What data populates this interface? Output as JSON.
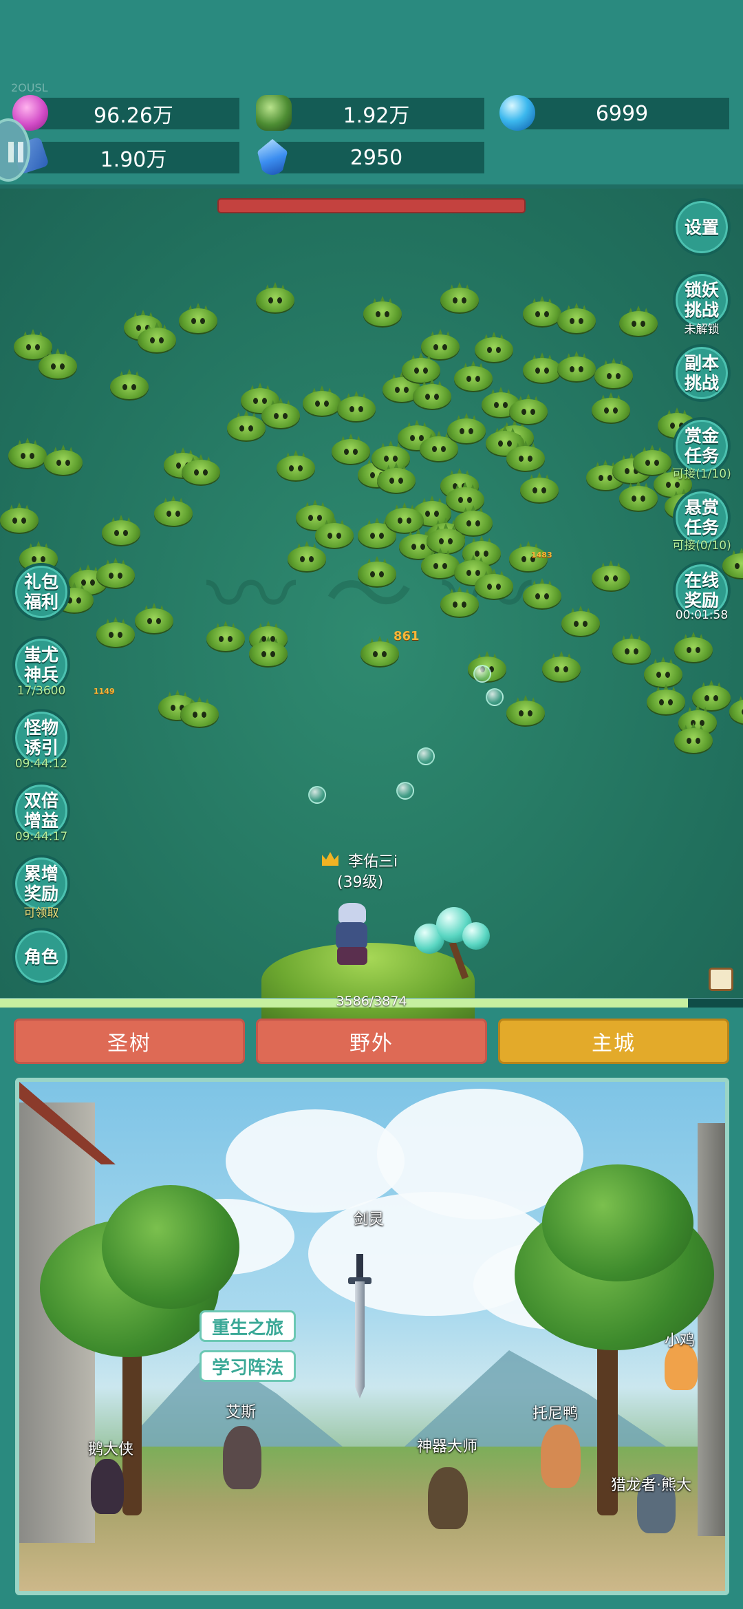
{
  "watermark": "2OUSL",
  "resources": [
    {
      "icon": "gem-icon",
      "value": "96.26万"
    },
    {
      "icon": "leaf-icon",
      "value": "1.92万"
    },
    {
      "icon": "orb-icon",
      "value": "6999"
    },
    {
      "icon": "book-icon",
      "value": "1.90万"
    },
    {
      "icon": "crystal-icon",
      "value": "2950"
    }
  ],
  "right_buttons": [
    {
      "label": "设置",
      "sub": ""
    },
    {
      "label": "锁妖挑战",
      "sub": "未解锁"
    },
    {
      "label": "副本挑战",
      "sub": ""
    },
    {
      "label": "赏金任务",
      "sub": "可接(1/10)"
    },
    {
      "label": "悬赏任务",
      "sub": "可接(0/10)"
    },
    {
      "label": "在线奖励",
      "sub": "00:01:58"
    }
  ],
  "left_buttons": [
    {
      "label": "礼包福利",
      "sub": ""
    },
    {
      "label": "蚩尤神兵",
      "sub": "17/3600"
    },
    {
      "label": "怪物诱引",
      "sub": "09:44:12"
    },
    {
      "label": "双倍增益",
      "sub": "09:44:17"
    },
    {
      "label": "累增奖励",
      "sub": "可领取"
    },
    {
      "label": "角色",
      "sub": ""
    }
  ],
  "hero": {
    "name": "李佑三i",
    "level": "(39级)"
  },
  "damage_numbers": [
    "861",
    "1483",
    "1149"
  ],
  "xp": {
    "text": "3586/3874",
    "current": 3586,
    "max": 3874
  },
  "tabs": [
    "圣树",
    "野外",
    "主城"
  ],
  "active_tab": "主城",
  "city": {
    "sword_name": "剑灵",
    "menu": [
      "重生之旅",
      "学习阵法"
    ],
    "npcs": [
      "艾斯",
      "鹅大侠",
      "神器大师",
      "托尼鸭",
      "小鸡",
      "猎龙者·熊大"
    ]
  }
}
